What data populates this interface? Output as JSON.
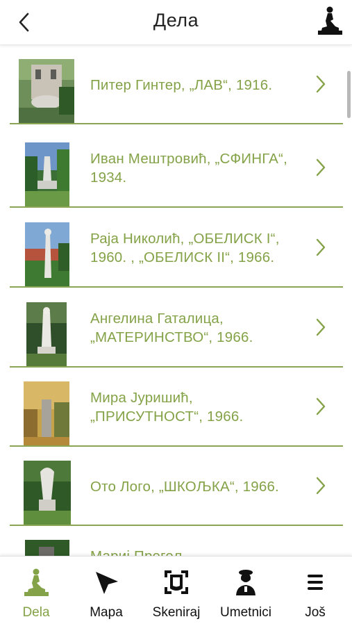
{
  "header": {
    "title": "Дела"
  },
  "items": [
    {
      "title": "Питер Гинтер, „ЛАВ“, 1916."
    },
    {
      "title": "Иван Мештровић, „СФИНГА“, 1934."
    },
    {
      "title": "Раја Николић, „ОБЕЛИСК I“, 1960. , „ОБЕЛИСК II“, 1966."
    },
    {
      "title": "Ангелина Гаталица, „МАТЕРИНСТВО“, 1966."
    },
    {
      "title": "Мира Јуришић, „ПРИСУТНОСТ“, 1966."
    },
    {
      "title": "Ото Лого, „ШКОЉКА“, 1966."
    },
    {
      "title": "Мариј Прегељ, ..."
    }
  ],
  "tabs": [
    {
      "label": "Dela",
      "icon": "statue-icon",
      "active": true
    },
    {
      "label": "Mapa",
      "icon": "pointer-icon",
      "active": false
    },
    {
      "label": "Skeniraj",
      "icon": "scan-icon",
      "active": false
    },
    {
      "label": "Umetnici",
      "icon": "artist-icon",
      "active": false
    },
    {
      "label": "Još",
      "icon": "menu-icon",
      "active": false
    }
  ],
  "colors": {
    "accent": "#84a247",
    "divider": "#8aa655"
  }
}
